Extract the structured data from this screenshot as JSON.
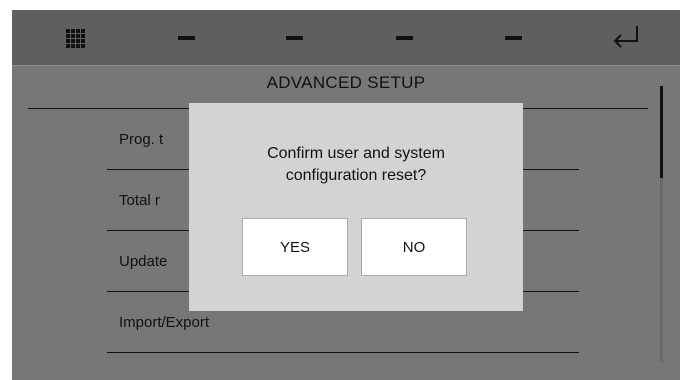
{
  "topbar": {
    "icons": [
      "grid-menu-icon",
      "dash-icon",
      "dash-icon",
      "dash-icon",
      "dash-icon",
      "enter-return-icon"
    ]
  },
  "screen": {
    "title": "ADVANCED SETUP",
    "menu_items": [
      {
        "label": "Prog. t"
      },
      {
        "label": "Total r"
      },
      {
        "label": "Update"
      },
      {
        "label": "Import/Export"
      }
    ]
  },
  "dialog": {
    "message_line1": "Confirm user and system",
    "message_line2": "configuration reset?",
    "yes_label": "YES",
    "no_label": "NO"
  },
  "colors": {
    "screen_bg": "#777777",
    "topbar_bg": "#5f5f5f",
    "dialog_bg": "#d3d3d3",
    "button_bg": "#ffffff"
  }
}
